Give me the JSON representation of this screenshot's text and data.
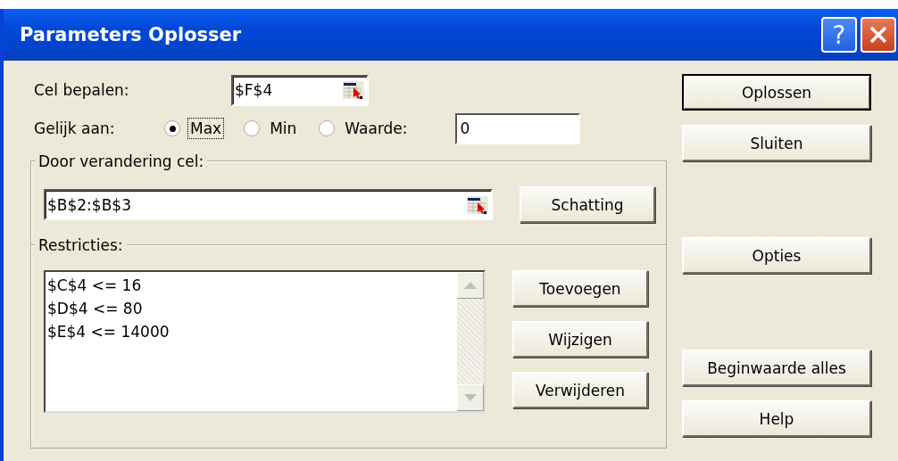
{
  "window": {
    "title": "Parameters Oplosser"
  },
  "title_buttons": [
    {
      "kind": "help",
      "label": "?"
    },
    {
      "kind": "close"
    }
  ],
  "target_cell": {
    "label": "Cel bepalen:",
    "value": "$F$4"
  },
  "equal_to": {
    "label": "Gelijk aan:",
    "options": [
      {
        "label": "Max",
        "selected": true,
        "focused": true
      },
      {
        "label": "Min",
        "selected": false,
        "focused": false
      },
      {
        "label": "Waarde:",
        "selected": false,
        "focused": false
      }
    ],
    "value": "0"
  },
  "changing_cells": {
    "legend": "Door verandering cel:",
    "value": "$B$2:$B$3",
    "button": {
      "label": "Schatting"
    }
  },
  "constraints": {
    "legend": "Restricties:",
    "items": [
      "$C$4 <= 16",
      "$D$4 <= 80",
      "$E$4 <= 14000"
    ],
    "buttons": [
      {
        "label": "Toevoegen"
      },
      {
        "label": "Wijzigen"
      },
      {
        "label": "Verwijderen"
      }
    ]
  },
  "actions": [
    {
      "label": "Oplossen",
      "default": true
    },
    {
      "label": "Sluiten",
      "default": false
    },
    {
      "label": "Opties",
      "default": false
    },
    {
      "label": "Beginwaarde alles",
      "default": false
    },
    {
      "label": "Help",
      "default": false
    }
  ]
}
